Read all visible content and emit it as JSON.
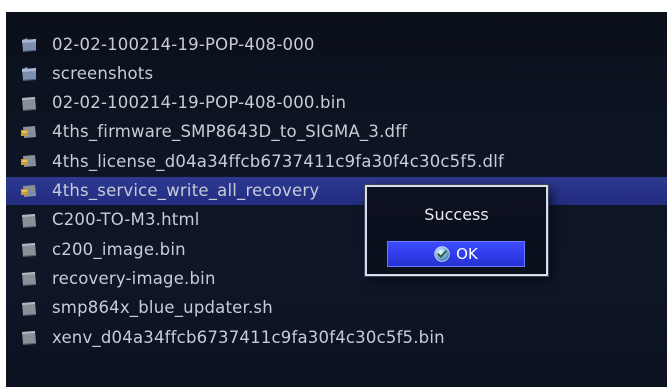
{
  "file_browser": {
    "items": [
      {
        "name": "02-02-100214-19-POP-408-000",
        "type": "folder",
        "selected": false
      },
      {
        "name": "screenshots",
        "type": "folder",
        "selected": false
      },
      {
        "name": "02-02-100214-19-POP-408-000.bin",
        "type": "file",
        "selected": false
      },
      {
        "name": "4ths_firmware_SMP8643D_to_SIGMA_3.dff",
        "type": "special-file",
        "selected": false
      },
      {
        "name": "4ths_license_d04a34ffcb6737411c9fa30f4c30c5f5.dlf",
        "type": "special-file",
        "selected": false
      },
      {
        "name": "4ths_service_write_all_recovery",
        "type": "special-file",
        "selected": true
      },
      {
        "name": "C200-TO-M3.html",
        "type": "file",
        "selected": false
      },
      {
        "name": "c200_image.bin",
        "type": "file",
        "selected": false
      },
      {
        "name": "recovery-image.bin",
        "type": "file",
        "selected": false
      },
      {
        "name": "smp864x_blue_updater.sh",
        "type": "file",
        "selected": false
      },
      {
        "name": "xenv_d04a34ffcb6737411c9fa30f4c30c5f5.bin",
        "type": "file",
        "selected": false
      }
    ]
  },
  "dialog": {
    "title": "Success",
    "ok_label": "OK",
    "ok_icon": "checkmark-icon"
  },
  "colors": {
    "background": "#0d1423",
    "selection": "#27328a",
    "text": "#c8ccd6",
    "button": "#2f3ce8",
    "icon_folder": "#7c8fb0",
    "icon_file": "#8a8f99"
  }
}
